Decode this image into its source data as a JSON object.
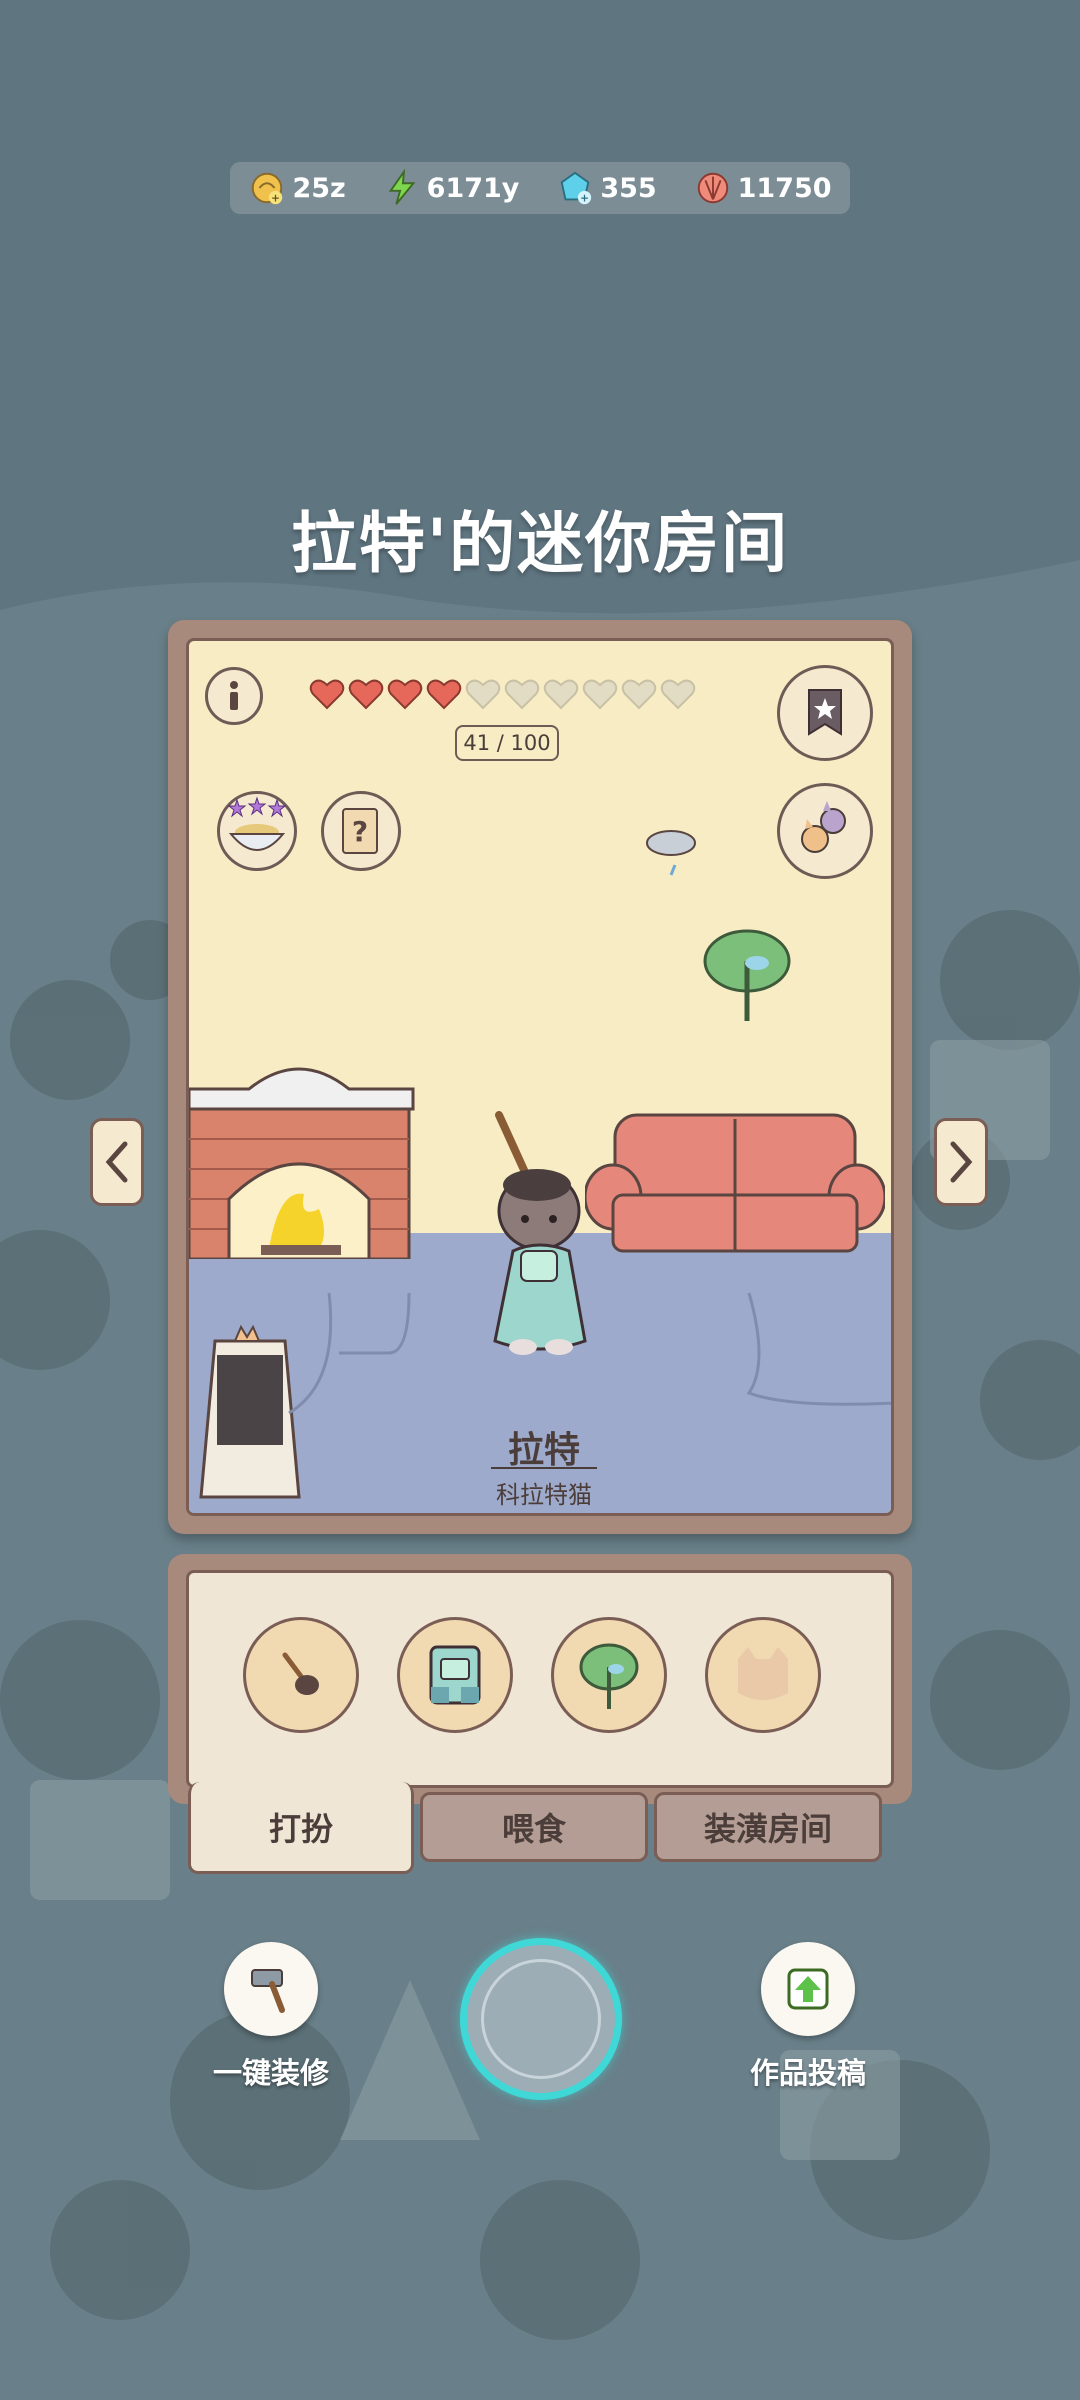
{
  "currency": [
    {
      "icon": "coin-icon",
      "value": "25z"
    },
    {
      "icon": "energy-bolt-icon",
      "value": "6171y"
    },
    {
      "icon": "gem-icon",
      "value": "355"
    },
    {
      "icon": "shell-icon",
      "value": "11750"
    }
  ],
  "room": {
    "title": "拉特'的迷你房间",
    "affinity_text": "41 / 100",
    "affinity_value": 41,
    "affinity_max": 100,
    "hearts_filled": 4,
    "hearts_total": 10,
    "character_name": "拉特",
    "character_breed": "科拉特猫",
    "food_bowl_stars": 3
  },
  "items": [
    {
      "icon": "shovel-icon"
    },
    {
      "icon": "overalls-icon"
    },
    {
      "icon": "lotus-leaf-icon"
    },
    {
      "icon": "cat-silhouette-icon"
    }
  ],
  "tabs": [
    {
      "label": "打扮",
      "active": true
    },
    {
      "label": "喂食",
      "active": false
    },
    {
      "label": "装潢房间",
      "active": false
    }
  ],
  "bottom": {
    "left_label": "一键装修",
    "right_label": "作品投稿"
  },
  "colors": {
    "background": "#5f7580",
    "card_border": "#a88a7c",
    "heart_full": "#e5685a",
    "accent_ring": "#40d8d6"
  }
}
